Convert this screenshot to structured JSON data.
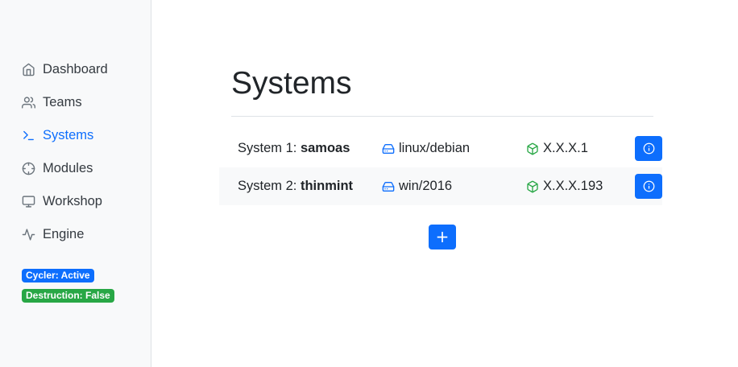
{
  "sidebar": {
    "items": [
      {
        "label": "Dashboard",
        "icon": "home-icon"
      },
      {
        "label": "Teams",
        "icon": "users-icon"
      },
      {
        "label": "Systems",
        "icon": "terminal-icon",
        "active": true
      },
      {
        "label": "Modules",
        "icon": "crosshair-icon"
      },
      {
        "label": "Workshop",
        "icon": "monitor-icon"
      },
      {
        "label": "Engine",
        "icon": "activity-icon"
      }
    ],
    "badges": [
      {
        "label": "Cycler: Active",
        "color": "#0d6efd"
      },
      {
        "label": "Destruction: False",
        "color": "#28a745"
      }
    ]
  },
  "main": {
    "title": "Systems",
    "systems": [
      {
        "prefix": "System 1: ",
        "name": "samoas",
        "os": "linux/debian",
        "ip": "X.X.X.1"
      },
      {
        "prefix": "System 2: ",
        "name": "thinmint",
        "os": "win/2016",
        "ip": "X.X.X.193"
      }
    ],
    "add_label": "+"
  },
  "colors": {
    "accent": "#0d6efd",
    "success": "#28a745",
    "os_icon": "#0d6efd",
    "ip_icon": "#28a745"
  }
}
